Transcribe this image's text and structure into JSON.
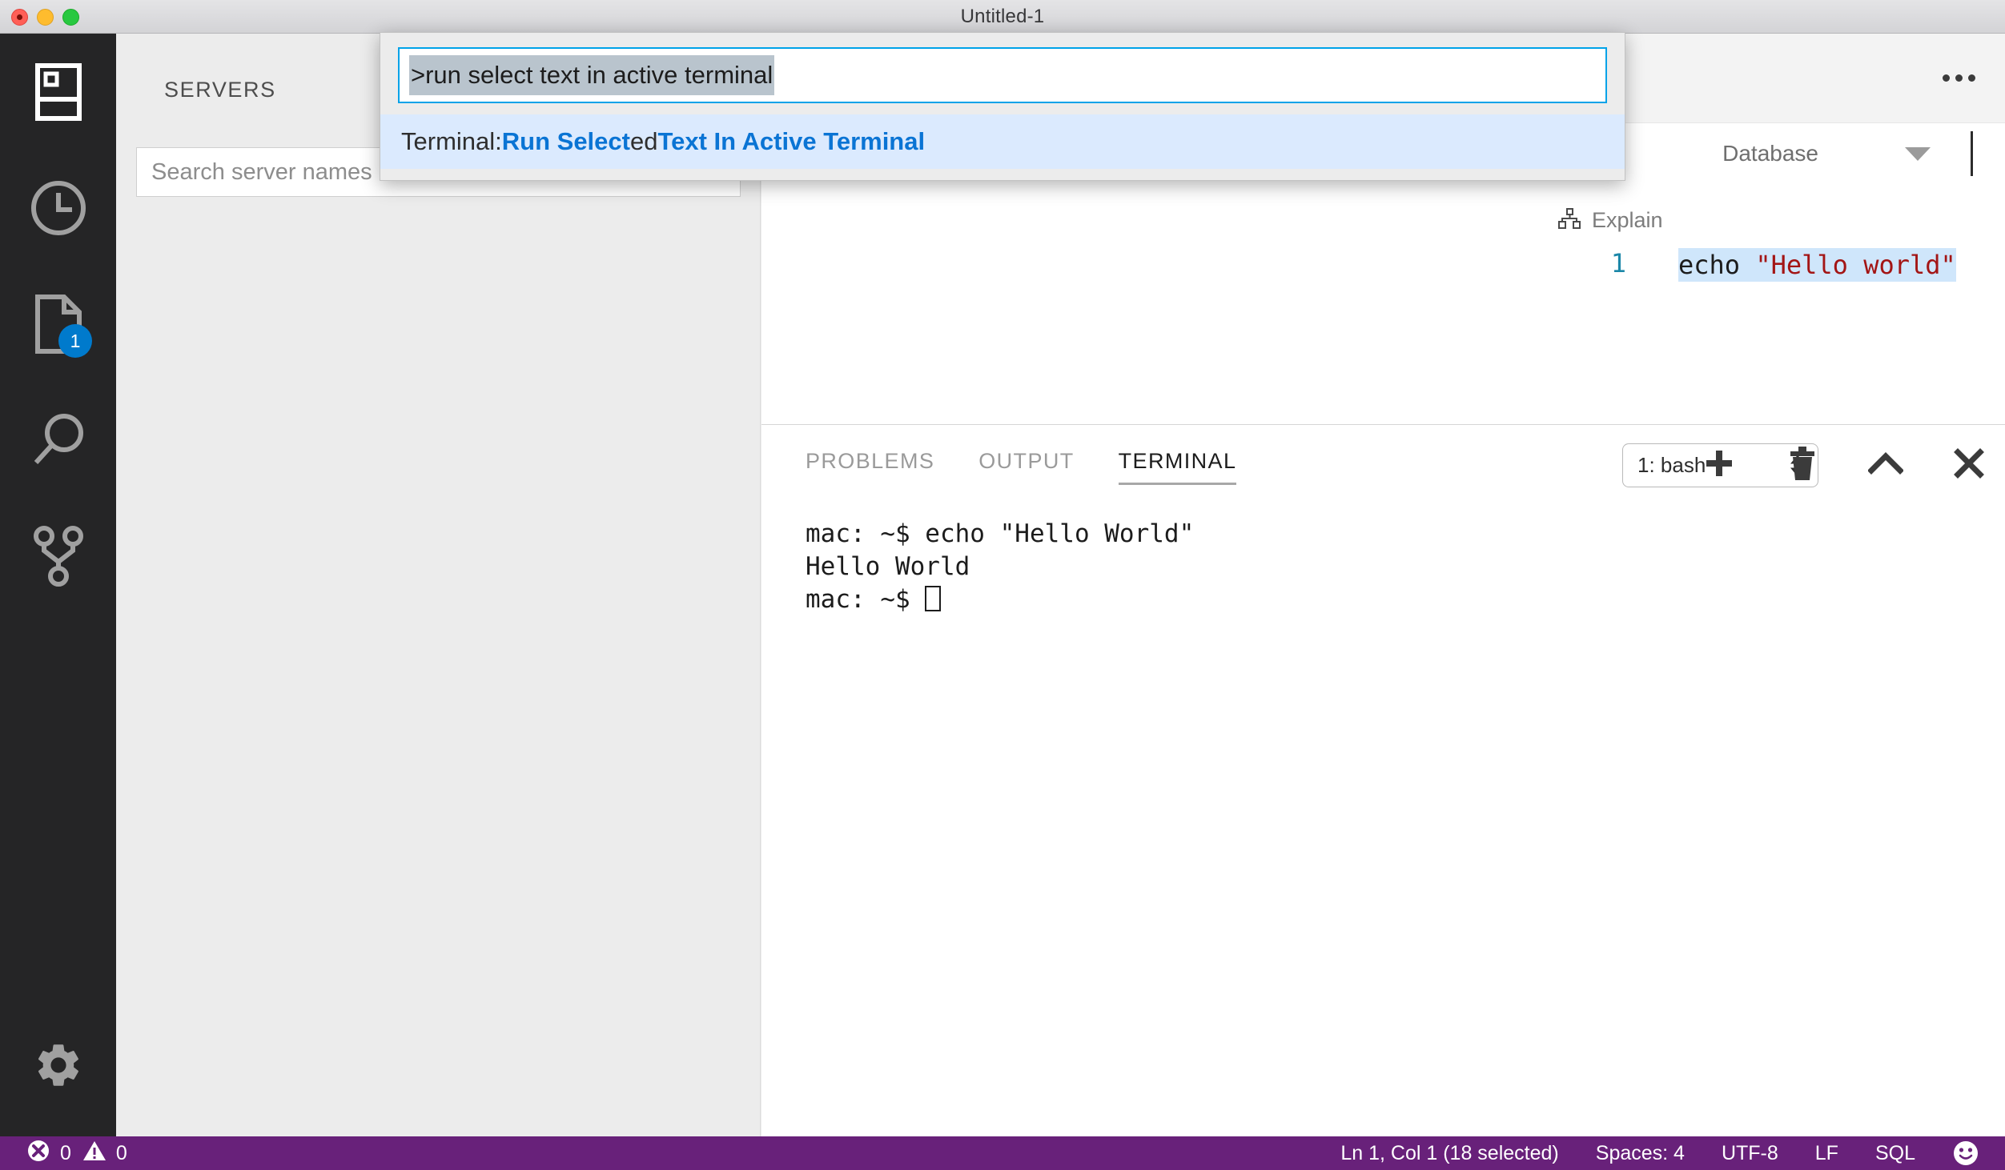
{
  "window": {
    "title": "Untitled-1",
    "traffic_lights": [
      "close",
      "minimize",
      "maximize"
    ]
  },
  "activitybar": {
    "items": [
      {
        "name": "servers-icon",
        "label": "Servers"
      },
      {
        "name": "history-icon",
        "label": "History"
      },
      {
        "name": "file-icon",
        "label": "Open Editors",
        "badge": "1"
      },
      {
        "name": "search-icon",
        "label": "Search"
      },
      {
        "name": "source-control-icon",
        "label": "Source Control"
      }
    ],
    "gear": {
      "name": "gear-icon",
      "label": "Manage"
    }
  },
  "sidebar": {
    "title": "SERVERS",
    "search_placeholder": "Search server names"
  },
  "editor": {
    "more_actions": "...",
    "database_label": "Database",
    "explain_label": "Explain",
    "line_number": "1",
    "code_prefix": "echo ",
    "code_string": "\"Hello world\""
  },
  "panel": {
    "tabs": [
      {
        "label": "PROBLEMS",
        "active": false
      },
      {
        "label": "OUTPUT",
        "active": false
      },
      {
        "label": "TERMINAL",
        "active": true
      }
    ],
    "terminal_select": "1: bash",
    "actions": [
      {
        "name": "new-terminal-button",
        "label": "+"
      },
      {
        "name": "kill-terminal-button",
        "label": "trash"
      },
      {
        "name": "maximize-panel-button",
        "label": "chevron-up"
      },
      {
        "name": "close-panel-button",
        "label": "close"
      }
    ],
    "terminal_lines": [
      "mac: ~$ echo \"Hello World\"",
      "Hello World"
    ],
    "terminal_prompt": "mac: ~$ "
  },
  "quickopen": {
    "input_value": ">run select text in active terminal",
    "suggestion": {
      "prefix": "Terminal: ",
      "segments": [
        {
          "text": "Run Select",
          "highlight": true
        },
        {
          "text": "ed ",
          "highlight": false
        },
        {
          "text": "Text In Active Terminal",
          "highlight": true
        }
      ]
    }
  },
  "statusbar": {
    "errors": "0",
    "warnings": "0",
    "cursor_position": "Ln 1, Col 1 (18 selected)",
    "indentation": "Spaces: 4",
    "encoding": "UTF-8",
    "eol": "LF",
    "language": "SQL",
    "feedback": "smiley-icon"
  },
  "colors": {
    "statusbar_bg": "#68217a",
    "accent_blue": "#007acc",
    "focus_border": "#00a2e8",
    "selection": "#cfe6fb",
    "string_red": "#a31515",
    "linenum_teal": "#1b87a8"
  }
}
